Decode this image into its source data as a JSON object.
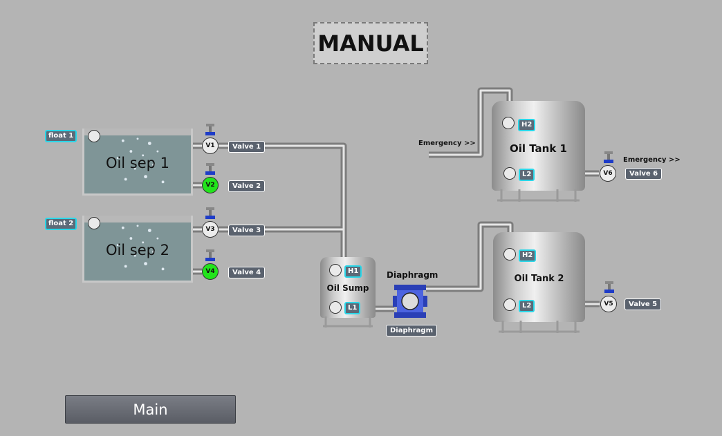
{
  "mode": "MANUAL",
  "separators": [
    {
      "label": "Oil sep 1",
      "float_tag": "float 1"
    },
    {
      "label": "Oil sep 2",
      "float_tag": "float 2"
    }
  ],
  "valves": [
    {
      "id": "V1",
      "tag": "Valve 1",
      "state": "off",
      "color": "#ececec"
    },
    {
      "id": "V2",
      "tag": "Valve 2",
      "state": "on",
      "color": "#22e41c"
    },
    {
      "id": "V3",
      "tag": "Valve 3",
      "state": "off",
      "color": "#ececec"
    },
    {
      "id": "V4",
      "tag": "Valve 4",
      "state": "on",
      "color": "#22e41c"
    },
    {
      "id": "V5",
      "tag": "Valve 5",
      "state": "off",
      "color": "#ececec"
    },
    {
      "id": "V6",
      "tag": "Valve 6",
      "state": "off",
      "color": "#ececec"
    }
  ],
  "sump": {
    "label": "Oil Sump",
    "high": "H1",
    "low": "L1"
  },
  "pump": {
    "title": "Diaphragm",
    "tag": "Diaphragm"
  },
  "tanks": [
    {
      "label": "Oil Tank 1",
      "high": "H2",
      "low": "L2"
    },
    {
      "label": "Oil Tank 2",
      "high": "H2",
      "low": "L2"
    }
  ],
  "emergency_in": "Emergency >>",
  "emergency_out": "Emergency >>",
  "nav": {
    "main_label": "Main"
  },
  "colors": {
    "background": "#b4b4b4",
    "valve_on": "#22e41c",
    "tag_border": "#2ad6e8"
  }
}
